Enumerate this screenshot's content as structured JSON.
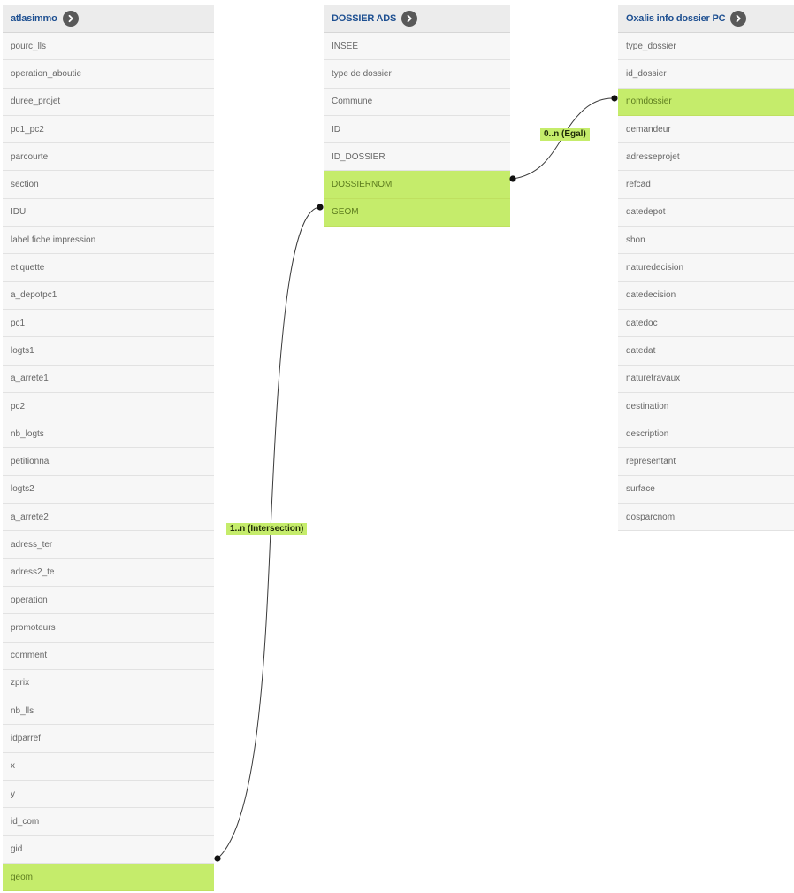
{
  "tables": {
    "t1": {
      "title": "atlasimmo",
      "rows": [
        "pourc_lls",
        "operation_aboutie",
        "duree_projet",
        "pc1_pc2",
        "parcourte",
        "section",
        "IDU",
        "label fiche impression",
        "etiquette",
        "a_depotpc1",
        "pc1",
        "logts1",
        "a_arrete1",
        "pc2",
        "nb_logts",
        "petitionna",
        "logts2",
        "a_arrete2",
        "adress_ter",
        "adress2_te",
        "operation",
        "promoteurs",
        "comment",
        "zprix",
        "nb_lls",
        "idparref",
        "x",
        "y",
        "id_com",
        "gid",
        "geom"
      ],
      "highlighted": [
        "geom"
      ]
    },
    "t2": {
      "title": "DOSSIER ADS",
      "rows": [
        "INSEE",
        "type de dossier",
        "Commune",
        "ID",
        "ID_DOSSIER",
        "DOSSIERNOM",
        "GEOM"
      ],
      "highlighted": [
        "DOSSIERNOM",
        "GEOM"
      ]
    },
    "t3": {
      "title": "Oxalis info dossier PC",
      "rows": [
        "type_dossier",
        "id_dossier",
        "nomdossier",
        "demandeur",
        "adresseprojet",
        "refcad",
        "datedepot",
        "shon",
        "naturedecision",
        "datedecision",
        "datedoc",
        "datedat",
        "naturetravaux",
        "destination",
        "description",
        "representant",
        "surface",
        "dosparcnom"
      ],
      "highlighted": [
        "nomdossier"
      ]
    }
  },
  "links": {
    "l1": {
      "label": "1..n (Intersection)"
    },
    "l2": {
      "label": "0..n (Egal)"
    }
  },
  "colors": {
    "header_text": "#1d4f91",
    "highlight": "#c5ec6b",
    "arrow_button": "#595959"
  }
}
